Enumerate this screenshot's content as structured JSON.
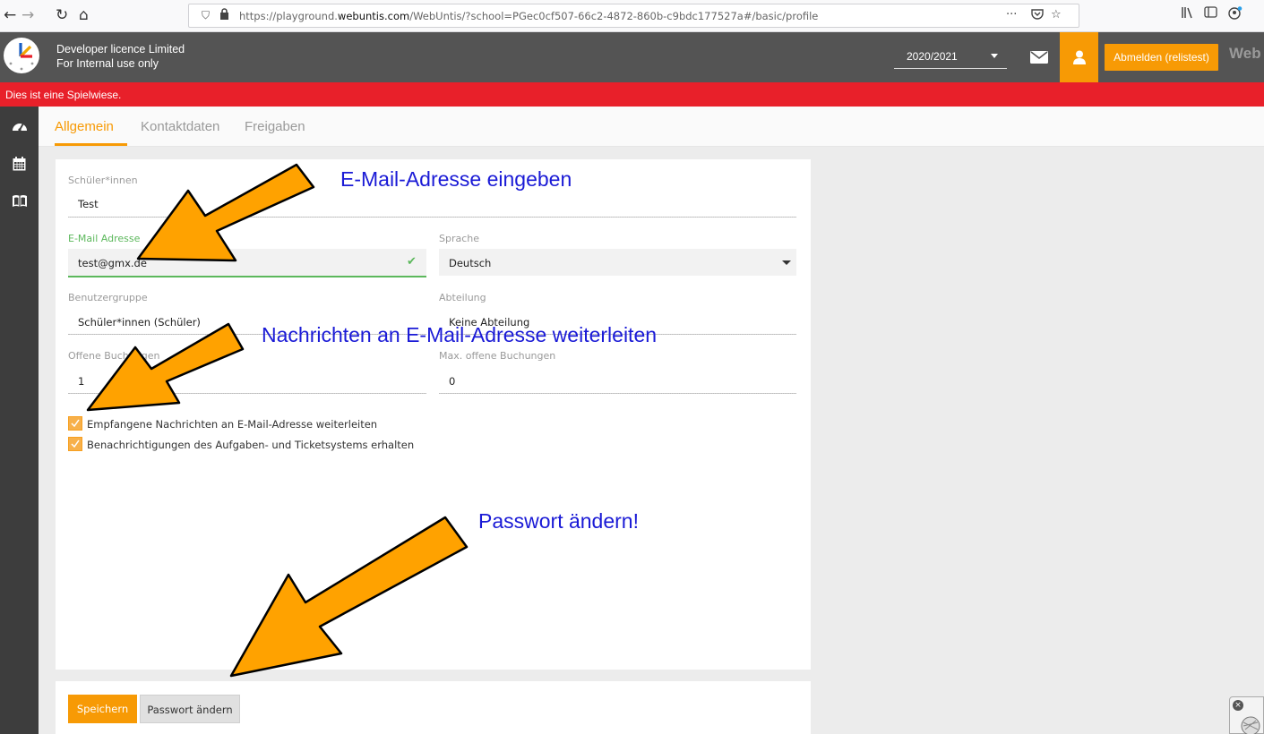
{
  "browser": {
    "url_prefix": "https://playground.",
    "url_domain": "webuntis.com",
    "url_suffix": "/WebUntis/?school=PGec0cf507-66c2-4872-860b-c9bdc177527a#/basic/profile",
    "more": "···"
  },
  "header": {
    "licence_line1": "Developer licence Limited",
    "licence_line2": "For Internal use only",
    "year": "2020/2021",
    "logout_label": "Abmelden (relistest)",
    "brand": "Web"
  },
  "banner": {
    "text": "Dies ist eine Spielwiese."
  },
  "tabs": [
    {
      "label": "Allgemein"
    },
    {
      "label": "Kontaktdaten"
    },
    {
      "label": "Freigaben"
    }
  ],
  "form": {
    "student_label": "Schüler*innen",
    "student_value": "Test",
    "email_label": "E-Mail Adresse",
    "email_value": "test@gmx.de",
    "language_label": "Sprache",
    "language_value": "Deutsch",
    "usergroup_label": "Benutzergruppe",
    "usergroup_value": "Schüler*innen (Schüler)",
    "department_label": "Abteilung",
    "department_value": "Keine Abteilung",
    "open_bookings_label": "Offene Buchungen",
    "open_bookings_value": "1",
    "max_open_bookings_label": "Max. offene Buchungen",
    "max_open_bookings_value": "0",
    "forward_messages_label": "Empfangene Nachrichten an E-Mail-Adresse weiterleiten",
    "ticket_notifications_label": "Benachrichtigungen des Aufgaben- und Ticketsystems erhalten"
  },
  "buttons": {
    "save": "Speichern",
    "change_password": "Passwort ändern"
  },
  "annotations": {
    "email": "E-Mail-Adresse eingeben",
    "forward": "Nachrichten an E-Mail-Adresse weiterleiten",
    "password": "Passwort ändern!"
  },
  "colors": {
    "accent": "#f79a05",
    "header": "#545454",
    "banner": "#e8202a",
    "annotation": "#1a1ad6",
    "valid": "#5cb85c"
  }
}
